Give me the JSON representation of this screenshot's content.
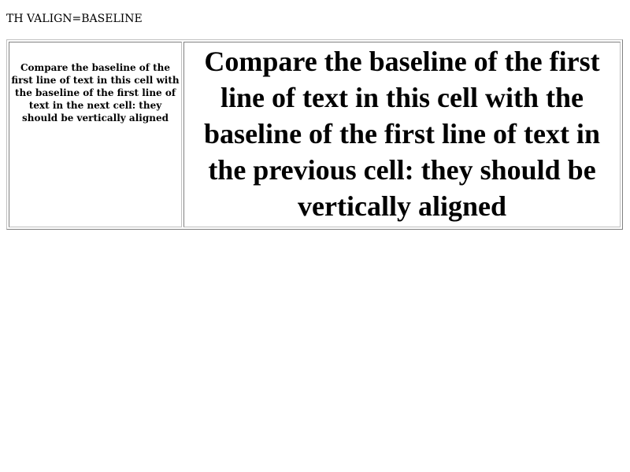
{
  "page": {
    "title": "TH VALIGN=BASELINE"
  },
  "table": {
    "cells": [
      {
        "text": "Compare the baseline of the first line of text in this cell with the baseline of the first line of text in the next cell: they should be vertically aligned"
      },
      {
        "text": "Compare the baseline of the first line of text in this cell with the baseline of the first line of text in the previous cell: they should be vertically aligned"
      }
    ]
  },
  "colors": {
    "background": "#ffffff",
    "text": "#000000",
    "border_dark": "#808080",
    "border_light": "#c0c0c0"
  }
}
